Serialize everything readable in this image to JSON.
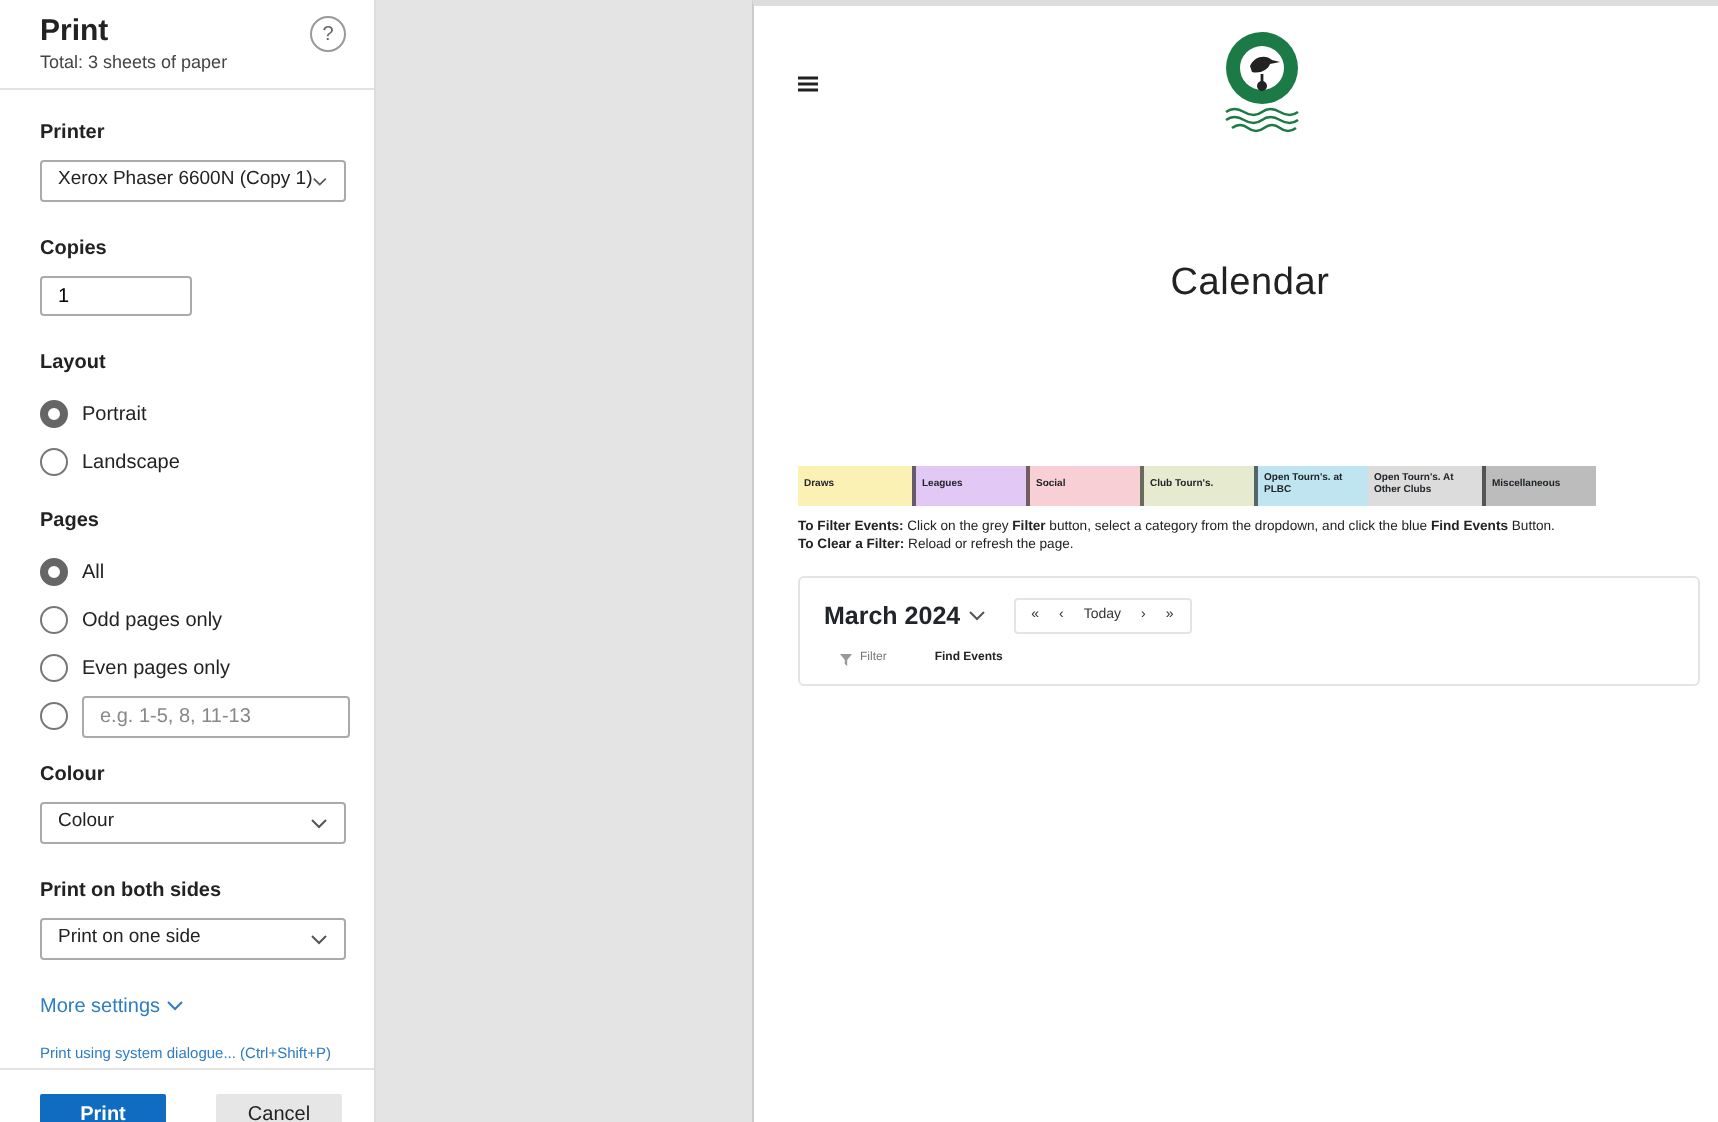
{
  "dialog": {
    "title": "Print",
    "subtitle": "Total: 3 sheets of paper",
    "help": "?",
    "printer": {
      "label": "Printer",
      "value": "Xerox Phaser 6600N (Copy 1)"
    },
    "copies": {
      "label": "Copies",
      "value": "1"
    },
    "layout": {
      "label": "Layout",
      "options": [
        {
          "label": "Portrait",
          "selected": true
        },
        {
          "label": "Landscape",
          "selected": false
        }
      ]
    },
    "pages": {
      "label": "Pages",
      "options": [
        {
          "kind": "text",
          "label": "All",
          "selected": true
        },
        {
          "kind": "text",
          "label": "Odd pages only",
          "selected": false
        },
        {
          "kind": "text",
          "label": "Even pages only",
          "selected": false
        },
        {
          "kind": "field",
          "placeholder": "e.g. 1-5, 8, 11-13",
          "selected": false
        }
      ]
    },
    "colour": {
      "label": "Colour",
      "value": "Colour"
    },
    "sides": {
      "label": "Print on both sides",
      "value": "Print on one side"
    },
    "more_settings": "More settings",
    "system_dialogue": "Print using system dialogue... (Ctrl+Shift+P)",
    "buttons": [
      {
        "kind": "primary",
        "label": "Print"
      },
      {
        "kind": "secondary",
        "label": "Cancel"
      }
    ]
  },
  "preview": {
    "heading": "Calendar",
    "legend": [
      {
        "label": "Draws",
        "color": "#fbf1b4",
        "edge": false
      },
      {
        "label": "Leagues",
        "color": "#e2c8f4",
        "edge": true
      },
      {
        "label": "Social",
        "color": "#f8cfd5",
        "edge": true
      },
      {
        "label": "Club Tourn's.",
        "color": "#e6ebcf",
        "edge": true
      },
      {
        "label": "Open Tourn's. at PLBC",
        "color": "#bfe5f1",
        "edge": true
      },
      {
        "label": "Open Tourn's. At Other Clubs",
        "color": "#dcdcdc",
        "edge": false
      },
      {
        "label": "Miscellaneous",
        "color": "#bcbcbc",
        "edge": true
      }
    ],
    "instructions": [
      "**To Filter Events:** Click on the grey **Filter** button, select a category from the dropdown, and click the blue **Find Events** Button.",
      "**To Clear a Filter:** Reload or refresh the page."
    ],
    "month": "March 2024",
    "nav": [
      "«",
      "‹",
      "Today",
      "›",
      "»"
    ],
    "filter": "Filter",
    "find_events": "Find Events"
  }
}
